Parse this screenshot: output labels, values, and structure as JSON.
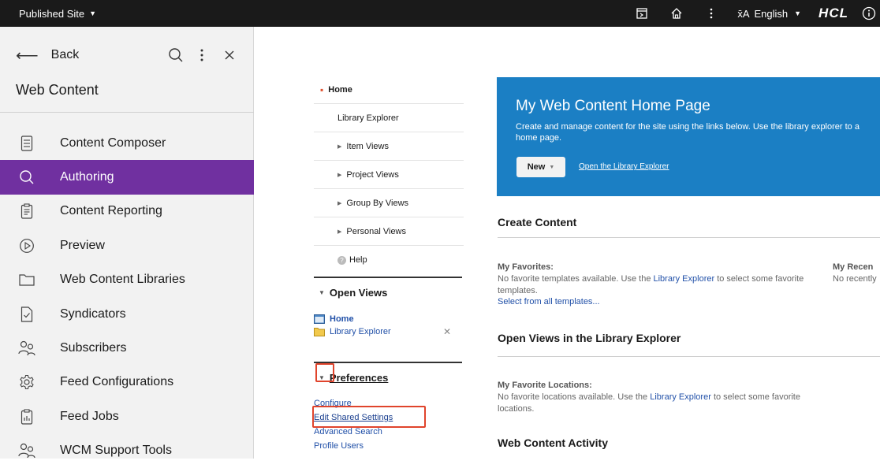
{
  "topbar": {
    "site_label": "Published Site",
    "language": "English",
    "brand": "HCL"
  },
  "sidebar": {
    "back_label": "Back",
    "title": "Web Content",
    "active_color": "#7030a0",
    "items": [
      {
        "label": "Content Composer",
        "icon": "document-list-icon"
      },
      {
        "label": "Authoring",
        "icon": "search-icon"
      },
      {
        "label": "Content Reporting",
        "icon": "clipboard-icon"
      },
      {
        "label": "Preview",
        "icon": "play-circle-icon"
      },
      {
        "label": "Web Content Libraries",
        "icon": "folder-icon"
      },
      {
        "label": "Syndicators",
        "icon": "document-check-icon"
      },
      {
        "label": "Subscribers",
        "icon": "users-icon"
      },
      {
        "label": "Feed Configurations",
        "icon": "gear-icon"
      },
      {
        "label": "Feed Jobs",
        "icon": "clipboard-chart-icon"
      },
      {
        "label": "WCM Support Tools",
        "icon": "users-icon"
      }
    ]
  },
  "portlet_nav": {
    "home": "Home",
    "library_explorer": "Library Explorer",
    "item_views": "Item Views",
    "project_views": "Project Views",
    "group_by_views": "Group By Views",
    "personal_views": "Personal Views",
    "help": "Help"
  },
  "open_views": {
    "title": "Open Views",
    "items": [
      "Home",
      "Library Explorer"
    ]
  },
  "preferences": {
    "title": "Preferences",
    "links": [
      "Configure",
      "Edit Shared Settings",
      "Advanced Search",
      "Profile Users"
    ]
  },
  "banner": {
    "title": "My Web Content Home Page",
    "description": "Create and manage content for the site using the links below. Use the library explorer to a",
    "description_line2": "home page.",
    "new_button": "New",
    "open_link": "Open the Library Explorer",
    "color": "#1b7fc4"
  },
  "main": {
    "create_content": "Create Content",
    "my_favorites_label": "My Favorites:",
    "my_recent_label": "My Recen",
    "favorites_text_1": "No favorite templates available. Use the",
    "favorites_link": "Library Explorer",
    "favorites_text_2": "to select some favorite",
    "favorites_text_3": "templates.",
    "recent_text": "No recently",
    "select_all_templates": "Select from all templates...",
    "open_views_title": "Open Views in the Library Explorer",
    "fav_locations_label": "My Favorite Locations:",
    "locations_text_1": "No favorite locations available. Use the",
    "locations_link": "Library Explorer",
    "locations_text_2": "to select some favorite",
    "locations_text_3": "locations.",
    "activity_title": "Web Content Activity"
  }
}
